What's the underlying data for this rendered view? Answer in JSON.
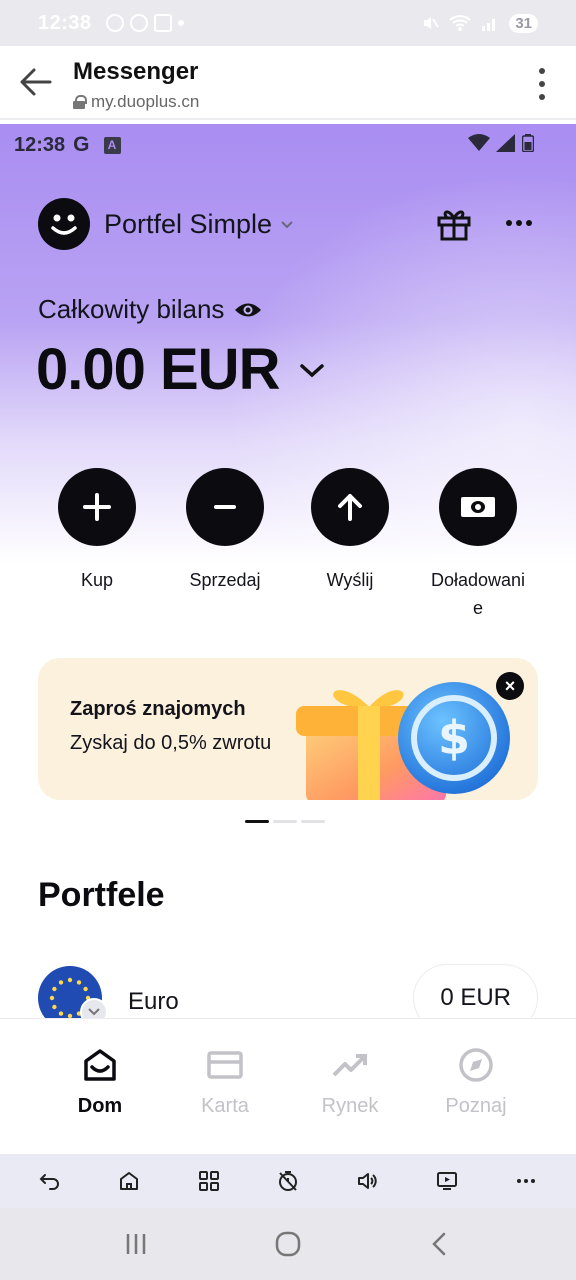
{
  "system_status": {
    "time": "12:38",
    "battery": "31"
  },
  "browser": {
    "title": "Messenger",
    "url": "my.duoplus.cn"
  },
  "inner_status": {
    "time": "12:38",
    "g_label": "G",
    "a_label": "A"
  },
  "wallet": {
    "name": "Portfel Simple"
  },
  "balance": {
    "label": "Całkowity bilans",
    "amount": "0.00 EUR"
  },
  "actions": [
    {
      "label": "Kup",
      "icon": "plus-icon"
    },
    {
      "label": "Sprzedaj",
      "icon": "minus-icon"
    },
    {
      "label": "Wyślij",
      "icon": "arrow-up-icon"
    },
    {
      "label_line1": "Doładowani",
      "label_line2": "e",
      "icon": "cash-icon"
    }
  ],
  "banner": {
    "title": "Zaproś znajomych",
    "subtitle": "Zyskaj do 0,5% zwrotu",
    "close": "×",
    "carousel_total": 3,
    "carousel_active": 1
  },
  "wallets_section": {
    "title": "Portfele",
    "items": [
      {
        "name": "Euro",
        "value": "0 EUR"
      }
    ]
  },
  "app_nav": [
    {
      "label": "Dom",
      "icon": "home-icon",
      "active": true
    },
    {
      "label": "Karta",
      "icon": "card-icon",
      "active": false
    },
    {
      "label": "Rynek",
      "icon": "trend-icon",
      "active": false
    },
    {
      "label": "Poznaj",
      "icon": "compass-icon",
      "active": false
    }
  ],
  "browser_toolbar": [
    "back-icon",
    "home-icon",
    "apps-icon",
    "timer-off-icon",
    "volume-icon",
    "screen-cast-icon",
    "more-icon"
  ],
  "colors": {
    "hero_purple": "#a98df2",
    "banner_bg": "#fbf1dc",
    "black": "#0b0b10",
    "nav_inactive": "#c2c2c8"
  }
}
